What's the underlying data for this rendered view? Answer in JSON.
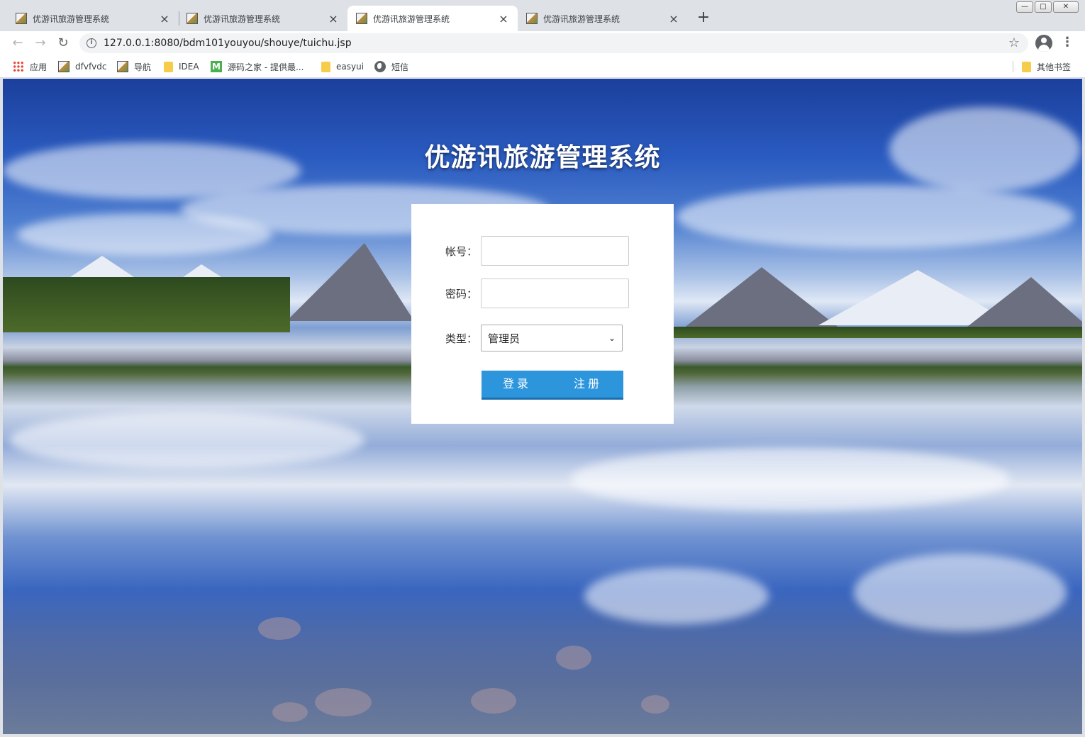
{
  "tabs": [
    {
      "title": "优游讯旅游管理系统",
      "active": false
    },
    {
      "title": "优游讯旅游管理系统",
      "active": false
    },
    {
      "title": "优游讯旅游管理系统",
      "active": true
    },
    {
      "title": "优游讯旅游管理系统",
      "active": false
    }
  ],
  "tab_close_glyph": "×",
  "new_tab_glyph": "+",
  "window_controls": {
    "minimize": "—",
    "maximize": "□",
    "close": "✕"
  },
  "nav": {
    "back": "←",
    "forward": "→",
    "reload": "↻"
  },
  "address_bar": {
    "info": "i",
    "url": "127.0.0.1:8080/bdm101youyou/shouye/tuichu.jsp",
    "star": "☆"
  },
  "menu_glyph": "⋮",
  "bookmarks": [
    {
      "label": "应用",
      "icon": "apps-icon"
    },
    {
      "label": "dfvfvdc",
      "icon": "image-icon"
    },
    {
      "label": "导航",
      "icon": "image-icon"
    },
    {
      "label": "IDEA",
      "icon": "folder-icon"
    },
    {
      "label": "源码之家 - 提供最...",
      "icon": "m-icon",
      "icon_text": "M"
    },
    {
      "label": "easyui",
      "icon": "folder-icon"
    },
    {
      "label": "短信",
      "icon": "globe-icon"
    }
  ],
  "other_bookmarks": "其他书签",
  "page": {
    "heading": "优游讯旅游管理系统",
    "form": {
      "account_label": "帐号：",
      "account_value": "",
      "password_label": "密码：",
      "password_value": "",
      "type_label": "类型：",
      "type_selected": "管理员",
      "type_chevron": "⌄",
      "login_button": "登录",
      "register_button": "注册"
    }
  },
  "colors": {
    "button_bg": "#2d95dc",
    "tabstrip_bg": "#dee1e6",
    "heading_text": "#ffffff"
  }
}
